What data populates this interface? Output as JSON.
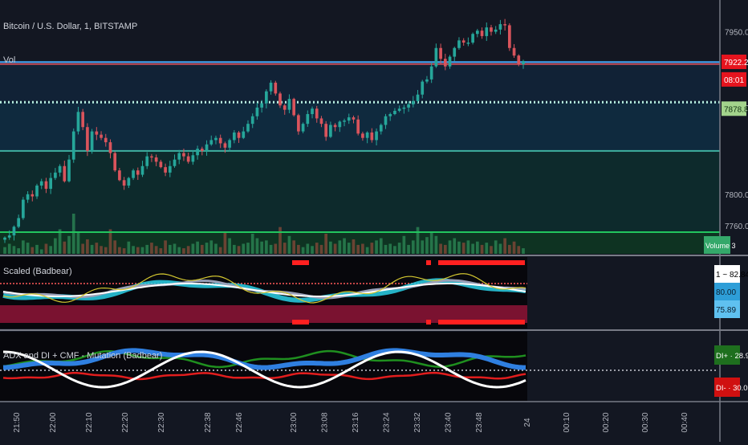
{
  "header": {
    "symbol": "Bitcoin / U.S. Dollar, 1, BITSTAMP",
    "vol_label": "Vol"
  },
  "main_pane": {
    "price_ticks": [
      {
        "label": "7950.00",
        "price": 7950
      },
      {
        "label": "7880.00",
        "price": 7880
      },
      {
        "label": "7800.00",
        "price": 7800
      }
    ],
    "price_badges": [
      {
        "label": "7922.23",
        "price": 7922.23,
        "color": "#e5141e"
      },
      {
        "label": "08:01",
        "price": 7906,
        "color": "#e5141e"
      },
      {
        "label": "7878.81",
        "price": 7879,
        "color": "#a3d48c"
      }
    ],
    "volume_badge": "Volume 3",
    "horizontal_levels": [
      {
        "price": 7922,
        "style": "solid",
        "color": "#42a5f5"
      },
      {
        "price": 7922,
        "style": "solid",
        "color": "#c44a56"
      },
      {
        "price": 7885,
        "style": "dotted",
        "color": "#b9f0e0"
      },
      {
        "price": 7840,
        "style": "solid",
        "color": "#3fb0a0"
      },
      {
        "price": 7765,
        "style": "solid",
        "color": "#22c55e"
      }
    ]
  },
  "pane2": {
    "title": "Scaled (Badbear)",
    "axis_badges": [
      {
        "label": "1 ~ 82.84",
        "color": "#ffffff",
        "text_color": "#000000"
      },
      {
        "label": "80.00",
        "color": "#2e9ed8",
        "text_color": "#0b2030"
      },
      {
        "label": "75.89",
        "color": "#5fc1f0",
        "text_color": "#0b2030"
      }
    ]
  },
  "pane3": {
    "title": "ADX and DI + CMF - Mutation (Badbear)",
    "axis_badges": [
      {
        "label": "DI+ · 28.90",
        "color": "#1e6f1e",
        "text_color": "#ffffff"
      },
      {
        "label": "DI- · 30.03",
        "color": "#d01010",
        "text_color": "#ffffff"
      }
    ]
  },
  "time_axis": [
    "21:50",
    "22:00",
    "22:10",
    "22:20",
    "22:30",
    "22:38",
    "22:46",
    "23:00",
    "23:08",
    "23:16",
    "23:24",
    "23:32",
    "23:40",
    "23:48",
    "24",
    "00:10",
    "00:20",
    "00:30",
    "00:40"
  ],
  "chart_data": {
    "type": "candlestick",
    "title": "Bitcoin / U.S. Dollar, 1, BITSTAMP",
    "ylim": [
      7745,
      7963
    ],
    "close": [
      7760,
      7762,
      7770,
      7778,
      7795,
      7800,
      7798,
      7808,
      7812,
      7805,
      7815,
      7820,
      7826,
      7812,
      7832,
      7858,
      7876,
      7862,
      7840,
      7858,
      7855,
      7852,
      7848,
      7838,
      7822,
      7813,
      7808,
      7815,
      7822,
      7818,
      7826,
      7835,
      7834,
      7830,
      7825,
      7820,
      7826,
      7832,
      7838,
      7835,
      7830,
      7836,
      7842,
      7840,
      7846,
      7850,
      7852,
      7847,
      7843,
      7850,
      7857,
      7852,
      7858,
      7865,
      7872,
      7880,
      7884,
      7895,
      7903,
      7893,
      7882,
      7878,
      7888,
      7873,
      7858,
      7865,
      7874,
      7879,
      7870,
      7865,
      7853,
      7864,
      7862,
      7867,
      7868,
      7871,
      7869,
      7856,
      7852,
      7857,
      7850,
      7858,
      7864,
      7872,
      7874,
      7877,
      7879,
      7880,
      7883,
      7886,
      7892,
      7904,
      7906,
      7918,
      7935,
      7925,
      7918,
      7927,
      7935,
      7942,
      7940,
      7940,
      7948,
      7951,
      7946,
      7954,
      7950,
      7952,
      7957,
      7956,
      7935,
      7928,
      7920,
      7923
    ],
    "volume": [
      6,
      9,
      7,
      5,
      12,
      10,
      6,
      8,
      4,
      9,
      7,
      14,
      22,
      11,
      16,
      36,
      20,
      9,
      13,
      8,
      10,
      7,
      6,
      22,
      12,
      6,
      5,
      11,
      7,
      6,
      6,
      8,
      10,
      7,
      5,
      12,
      8,
      9,
      6,
      5,
      7,
      9,
      11,
      8,
      10,
      12,
      9,
      6,
      20,
      14,
      8,
      7,
      9,
      10,
      18,
      14,
      11,
      12,
      8,
      9,
      24,
      10,
      16,
      12,
      8,
      6,
      9,
      7,
      10,
      8,
      18,
      11,
      9,
      12,
      14,
      10,
      13,
      8,
      9,
      6,
      10,
      12,
      14,
      8,
      9,
      7,
      10,
      16,
      8,
      12,
      24,
      12,
      15,
      20,
      16,
      9,
      8,
      12,
      14,
      11,
      10,
      12,
      9,
      11,
      8,
      10,
      7,
      12,
      9,
      14,
      8,
      11,
      7,
      5
    ],
    "series": [
      {
        "name": "Scaled (Badbear)",
        "values": []
      },
      {
        "name": "ADX and DI + CMF - Mutation (Badbear)",
        "values": []
      }
    ]
  }
}
